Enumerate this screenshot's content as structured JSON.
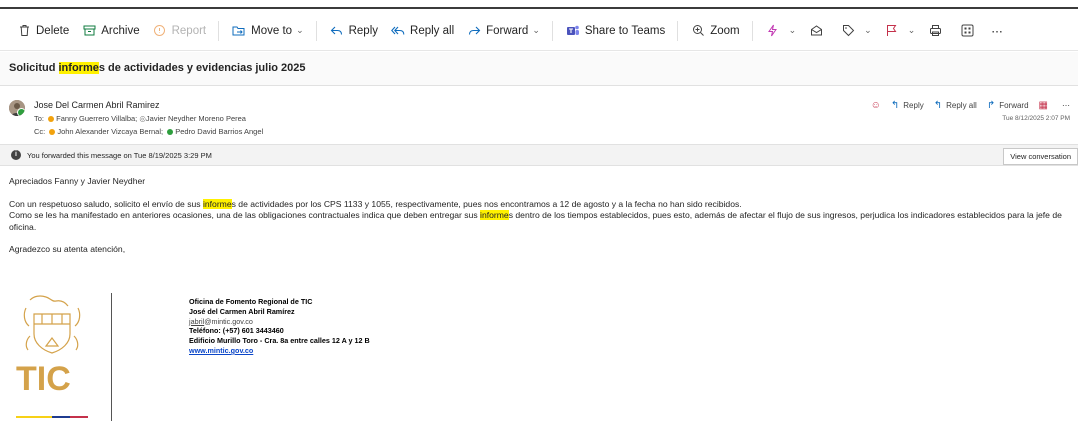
{
  "toolbar": {
    "delete": "Delete",
    "archive": "Archive",
    "report": "Report",
    "move_to": "Move to",
    "reply": "Reply",
    "reply_all": "Reply all",
    "forward": "Forward",
    "share_to_teams": "Share to Teams",
    "zoom": "Zoom",
    "more": "⋯"
  },
  "subject": {
    "before": "Solicitud ",
    "highlight": "informe",
    "after": "s de actividades y evidencias julio 2025"
  },
  "header": {
    "sender": "Jose Del Carmen Abril Ramirez",
    "to_label": "To:",
    "to_1": "Fanny Guerrero Villalba;",
    "to_2": "Javier Neydher Moreno Perea",
    "cc_label": "Cc:",
    "cc_1": "John Alexander Vizcaya Bernal;",
    "cc_2": "Pedro David Barrios Angel",
    "reply": "Reply",
    "reply_all": "Reply all",
    "forward": "Forward",
    "date": "Tue 8/12/2025 2:07 PM"
  },
  "infobar": {
    "text": "You forwarded this message on Tue 8/19/2025 3:29 PM",
    "button": "View conversation"
  },
  "body": {
    "greeting": "Apreciados Fanny y Javier Neydher",
    "p1_a": "Con un respetuoso saludo, solicito el envío de sus ",
    "p1_hl": "informe",
    "p1_b": "s de actividades por los CPS 1133 y 1055, respectivamente, pues nos encontramos a 12 de agosto y a la fecha no han sido recibidos.",
    "p2_a": "Como se les ha manifestado en anteriores ocasiones, una de las obligaciones contractuales indica que deben entregar sus ",
    "p2_hl": "informe",
    "p2_b": "s dentro de los tiempos establecidos, pues esto, además de afectar el flujo de sus ingresos, perjudica los indicadores establecidos para la jefe de oficina.",
    "closing": "Agradezco su atenta atención,"
  },
  "signature": {
    "logo_text": "TIC",
    "office": "Oficina de Fomento Regional de TIC",
    "name": "José del Carmen Abril Ramírez",
    "email_user": "jabril",
    "email_domain": "@mintic.gov.co",
    "phone": "Teléfono: (+57) 601 3443460",
    "address": "Edificio Murillo Toro - Cra. 8a entre calles 12 A y 12 B",
    "website": "www.mintic.gov.co"
  },
  "colors": {
    "highlight": "#fff100",
    "accent": "#0f6cbd",
    "flag_red": "#c4314b",
    "logo_gold": "#d4a24a"
  }
}
